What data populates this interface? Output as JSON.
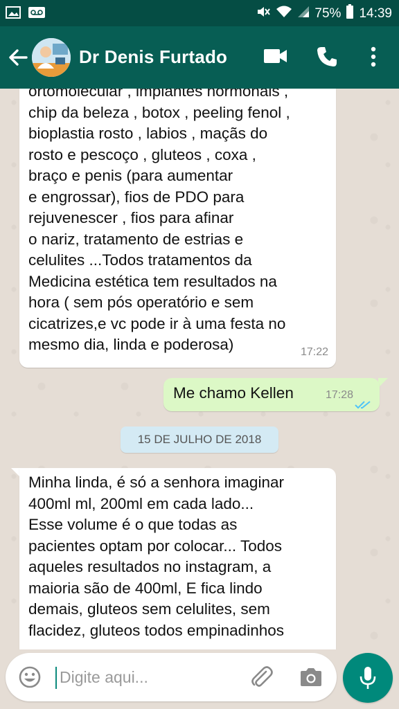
{
  "status_bar": {
    "battery": "75%",
    "time": "14:39",
    "left_icons": [
      "image-icon",
      "voicemail-icon"
    ],
    "right_icons": [
      "mute-icon",
      "wifi-icon",
      "signal-icon",
      "battery-icon"
    ]
  },
  "header": {
    "contact_name": "Dr Denis Furtado",
    "icons": [
      "back-arrow-icon",
      "avatar",
      "video-call-icon",
      "phone-icon",
      "menu-dots-icon"
    ]
  },
  "messages": [
    {
      "direction": "incoming",
      "text": "ortomolecular , implantes hormonais ,\nchip da beleza , botox , peeling fenol ,\nbioplastia rosto ,  labios , maçãs do\nrosto e pescoço , gluteos , coxa ,\nbraço e  penis (para aumentar\ne engrossar), fios de PDO para\nrejuvenescer , fios para afinar\no nariz, tratamento de estrias e\ncelulites ...Todos tratamentos da\nMedicina estética tem resultados  na\nhora ( sem pós operatório  e sem\ncicatrizes,e vc pode ir à uma festa no\nmesmo dia, linda e poderosa)",
      "time": "17:22"
    },
    {
      "direction": "outgoing",
      "text": "Me chamo Kellen",
      "time": "17:28",
      "status": "read"
    },
    {
      "direction": "incoming",
      "text": "Minha linda, é só a senhora imaginar\n400ml ml, 200ml em cada lado...\nEsse volume é o que todas as\npacientes optam por colocar... Todos\naqueles resultados no instagram, a\nmaioria são de 400ml, E fica lindo\ndemais, gluteos sem celulites, sem\nflacidez, gluteos todos empinadinhos"
    }
  ],
  "date_separator": "15 DE JULHO DE 2018",
  "composer": {
    "placeholder": "Digite aqui...",
    "icons": [
      "emoji-icon",
      "attach-icon",
      "camera-icon",
      "mic-icon"
    ]
  },
  "colors": {
    "status_bar": "#054d44",
    "app_bar": "#075e54",
    "outgoing_bubble": "#dcf8c6",
    "chat_background": "#e5ddd5",
    "fab": "#00897b",
    "read_ticks": "#4fc3f7"
  }
}
